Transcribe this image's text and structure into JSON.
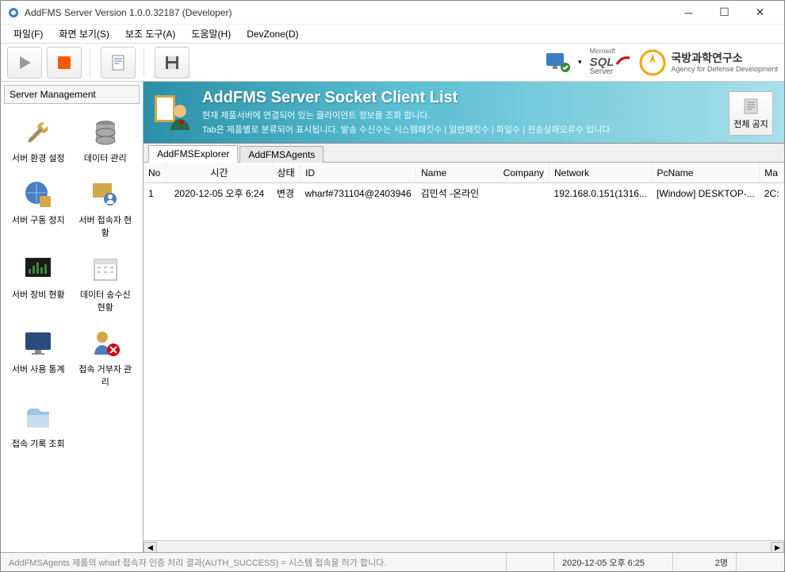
{
  "window": {
    "title": "AddFMS Server Version 1.0.0.32187 (Developer)"
  },
  "menubar": {
    "items": [
      "파일(F)",
      "화면 보기(S)",
      "보조 도구(A)",
      "도움말(H)",
      "DevZone(D)"
    ]
  },
  "toolbar_right": {
    "sql_label_top": "Microsoft",
    "sql_label": "SQL",
    "sql_label_sub": "Server",
    "org_name": "국방과학연구소",
    "org_sub": "Agency for Defense Development"
  },
  "sidebar": {
    "title": "Server Management",
    "items": [
      {
        "label": "서버 환경 설정"
      },
      {
        "label": "데이터 관리"
      },
      {
        "label": "서버 구동 정지"
      },
      {
        "label": "서버 접속자 현황"
      },
      {
        "label": "서버 장비 현황"
      },
      {
        "label": "데이터 송수신 현황"
      },
      {
        "label": "서버 사용 통계"
      },
      {
        "label": "접속 거부자 관리"
      },
      {
        "label": "접속 기록 조회"
      }
    ]
  },
  "banner": {
    "title": "AddFMS Server Socket Client List",
    "line1": "현재 제품서버에 연결되어 있는 클라이언트 정보를 조회 합니다.",
    "line2": "Tab은 제품별로 분류되어 표시됩니다. 발송 수신수는 시스템패킷수 | 일반패킷수 | 파일수 | 전송실패오류수 입니다.",
    "button_label": "전체 공지"
  },
  "tabs": [
    {
      "label": "AddFMSExplorer",
      "active": true
    },
    {
      "label": "AddFMSAgents",
      "active": false
    }
  ],
  "table": {
    "columns": [
      "No",
      "시간",
      "상태",
      "ID",
      "Name",
      "Company",
      "Network",
      "PcName",
      "Ma"
    ],
    "rows": [
      {
        "no": "1",
        "time": "2020-12-05 오후 6:24",
        "status": "변경",
        "id": "wharf#731104@2403946",
        "name": "김민석 -온라인",
        "company": "",
        "network": "192.168.0.151(1316...",
        "pcname": "[Window] DESKTOP-...",
        "ma": "2C:"
      }
    ]
  },
  "statusbar": {
    "message": "AddFMSAgents 제품의 wharf 접속자 인증 처리 결과(AUTH_SUCCESS) = 시스템 접속을 허가 합니다.",
    "time": "2020-12-05 오후 6:25",
    "count": "2명"
  }
}
